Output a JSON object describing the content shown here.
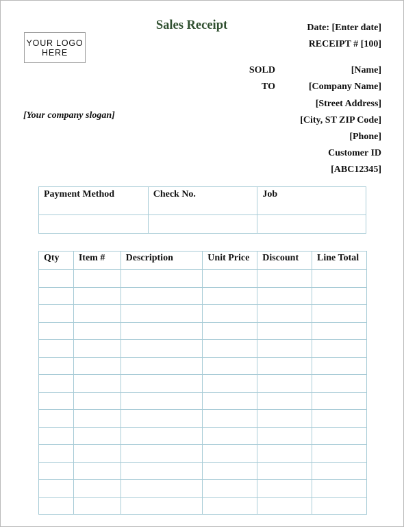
{
  "logo": {
    "line1": "YOUR LOGO",
    "line2": "HERE"
  },
  "title": "Sales Receipt",
  "slogan": "[Your company slogan]",
  "header": {
    "date": "Date: [Enter date]",
    "receipt": "RECEIPT # [100]"
  },
  "sold_to": {
    "label_line1": "SOLD",
    "label_line2": "TO",
    "name": "[Name]",
    "company": "[Company Name]",
    "street": "[Street Address]",
    "city": "[City, ST  ZIP Code]",
    "phone": "[Phone]",
    "customer_id_label": "Customer ID",
    "customer_id": "[ABC12345]"
  },
  "payment_table": {
    "headers": [
      "Payment Method",
      "Check No.",
      "Job"
    ],
    "rows": [
      [
        "",
        "",
        ""
      ]
    ]
  },
  "items_table": {
    "headers": [
      "Qty",
      "Item #",
      "Description",
      "Unit Price",
      "Discount",
      "Line Total"
    ],
    "row_count": 14
  },
  "colors": {
    "title": "#2f4f2f",
    "table_border": "#a7cbd6",
    "page_border": "#b9b9b9"
  }
}
